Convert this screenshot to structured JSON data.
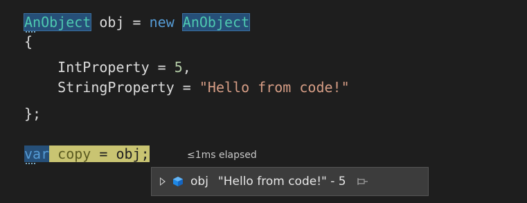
{
  "code": {
    "line1": {
      "type_a": "AnObject",
      "mid": " obj = ",
      "kw_new": "new",
      "space": " ",
      "type_b": "AnObject"
    },
    "line2": {
      "text": "{"
    },
    "line3": {
      "indent": "    ",
      "prop": "IntProperty",
      "eq": " = ",
      "value": "5",
      "comma": ","
    },
    "line4": {
      "indent": "    ",
      "prop": "StringProperty",
      "eq": " = ",
      "value": "\"Hello from code!\""
    },
    "line5": {
      "text": "};"
    },
    "line6": {
      "kw_var": "var",
      "space": " ",
      "ident": "copy",
      "rest": " = obj;"
    }
  },
  "perf_tip": {
    "text": "≤1ms elapsed"
  },
  "datatip": {
    "name": "obj",
    "value": "\"Hello from code!\" - 5",
    "icon": "object-icon",
    "expand_icon": "expand-arrow-icon",
    "pin_icon": "pin-icon"
  },
  "colors": {
    "background": "#1e1e1e",
    "keyword": "#569cd6",
    "type": "#4ec9b0",
    "string": "#d69d85",
    "number": "#b5cea8",
    "current_statement": "#c9c472",
    "datatip_bg": "#3c3c3c"
  }
}
